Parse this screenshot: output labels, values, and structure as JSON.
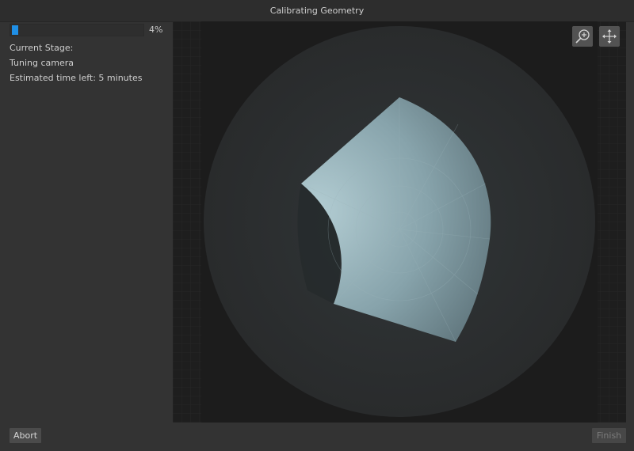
{
  "window": {
    "title": "Calibrating Geometry"
  },
  "progress": {
    "value": 0.04,
    "label": "4%",
    "accent": "#1f8fe6"
  },
  "status": {
    "stage_label": "Current Stage:",
    "stage_value": "Tuning camera",
    "time_left": "Estimated time left: 5 minutes"
  },
  "viewport": {
    "tools": [
      {
        "name": "zoom",
        "icon": "zoom-in-icon"
      },
      {
        "name": "pan",
        "icon": "move-icon"
      }
    ]
  },
  "buttons": {
    "abort": "Abort",
    "finish": "Finish"
  }
}
